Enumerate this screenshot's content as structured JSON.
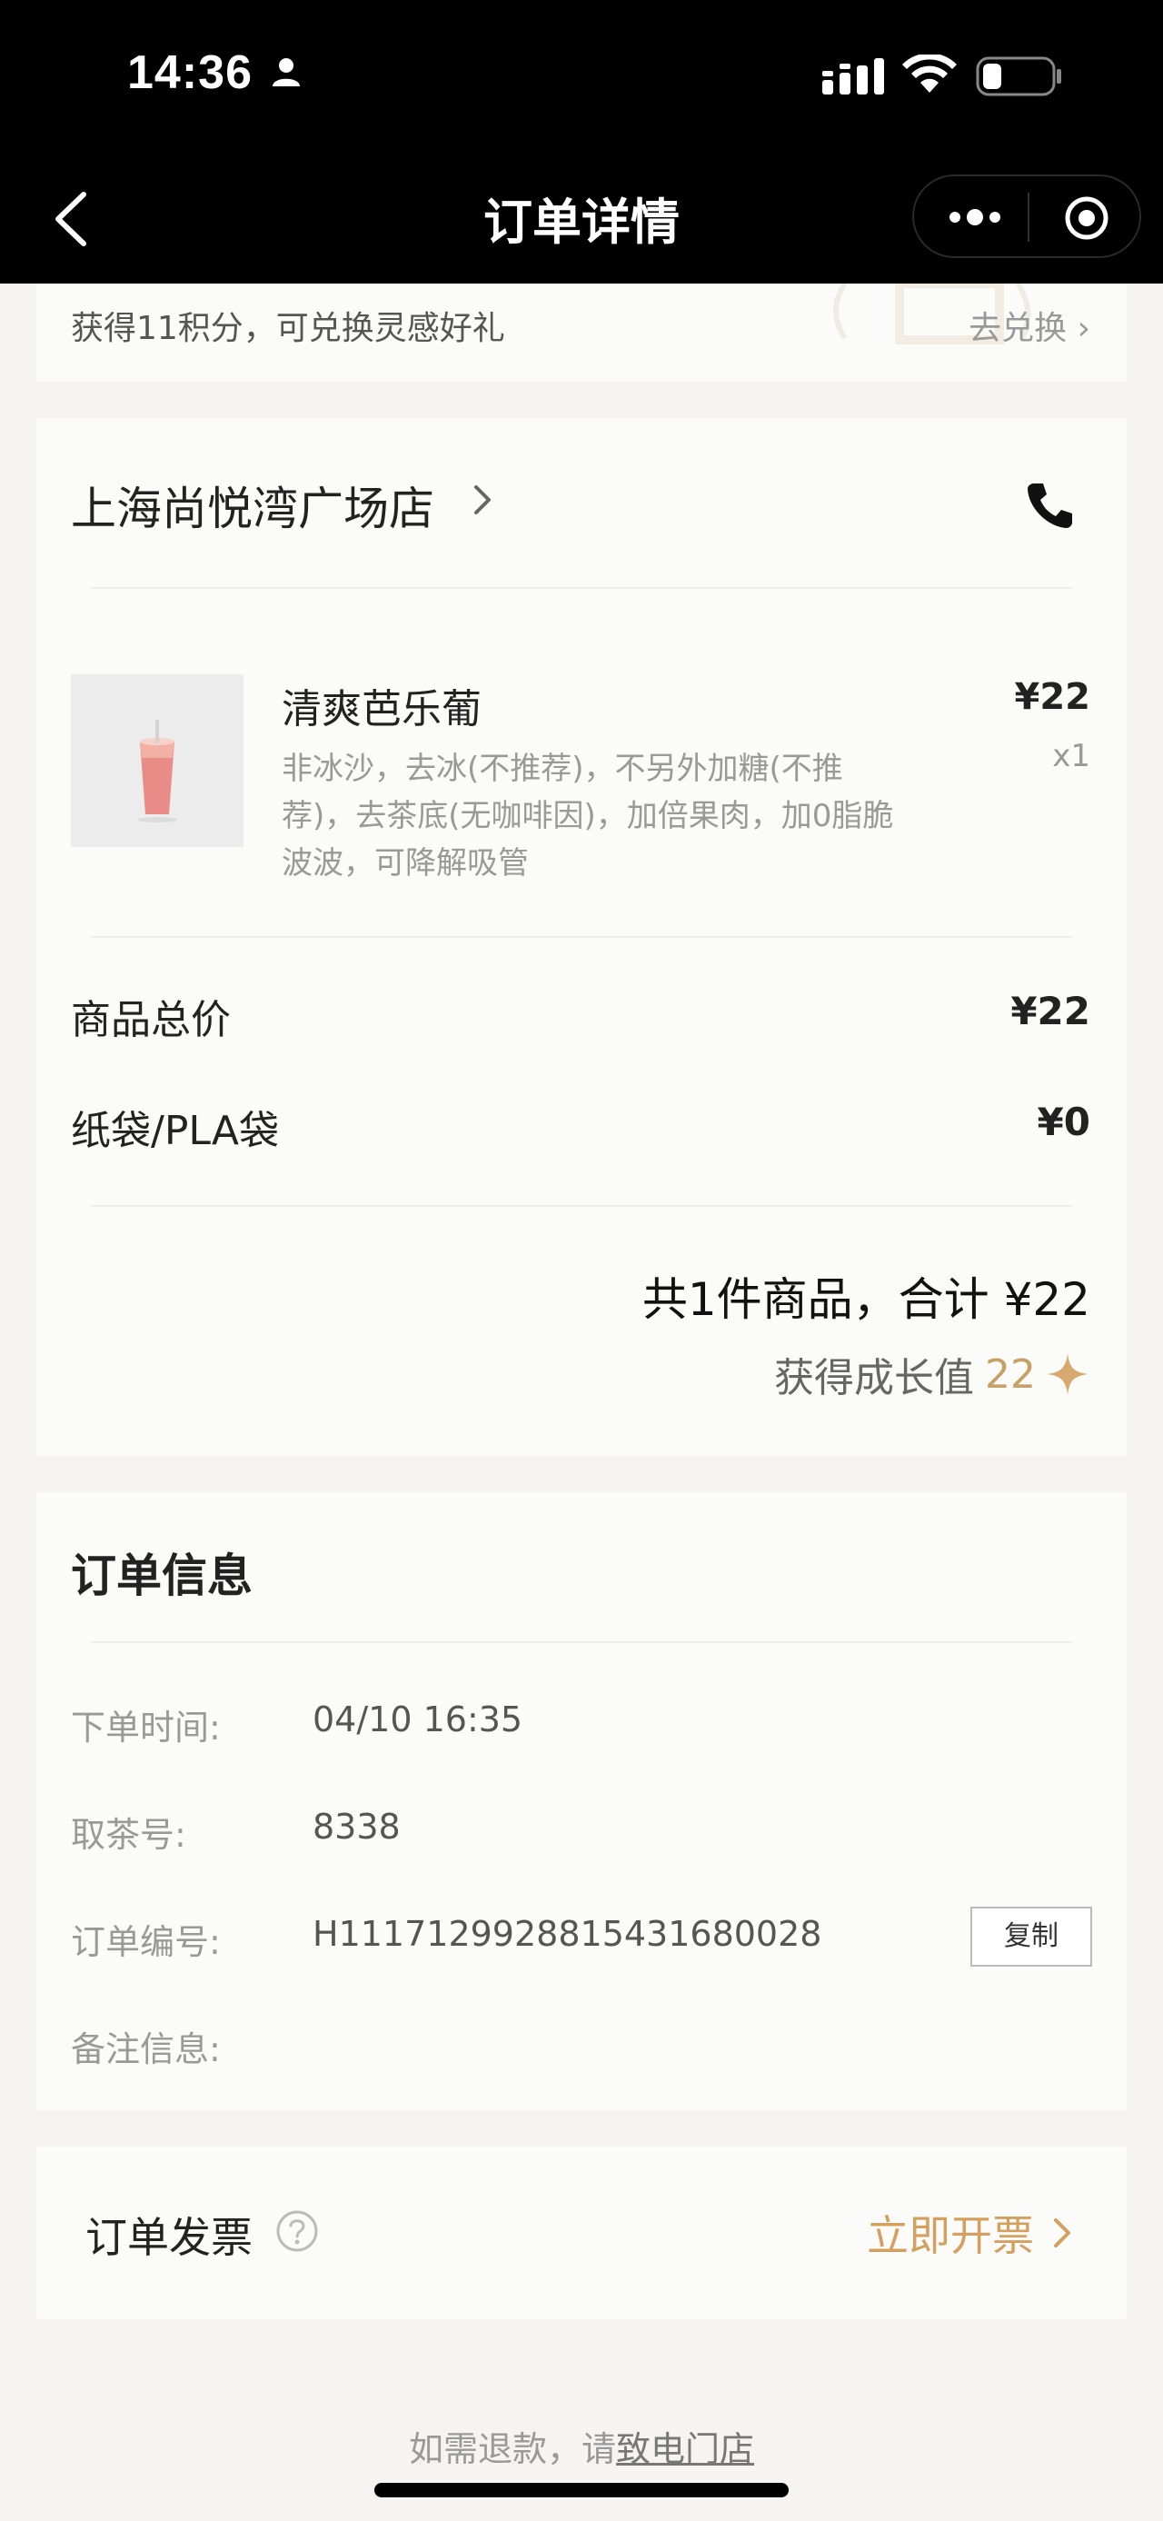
{
  "status_bar": {
    "time": "14:36"
  },
  "nav": {
    "title": "订单详情"
  },
  "points_card": {
    "text": "获得11积分，可兑换灵感好礼",
    "link": "去兑换"
  },
  "store": {
    "name": "上海尚悦湾广场店"
  },
  "product": {
    "name": "清爽芭乐葡",
    "price": "¥22",
    "qty": "x1",
    "spec": "非冰沙，去冰(不推荐)，不另外加糖(不推荐)，去茶底(无咖啡因)，加倍果肉，加0脂脆波波，可降解吸管"
  },
  "summary": {
    "rows": [
      {
        "label": "商品总价",
        "value": "¥22"
      },
      {
        "label": "纸袋/PLA袋",
        "value": "¥0"
      }
    ],
    "total": "共1件商品，合计 ¥22",
    "growth_label": "获得成长值",
    "growth_value": "22"
  },
  "order_info": {
    "title": "订单信息",
    "rows": [
      {
        "label": "下单时间:",
        "value": "04/10 16:35"
      },
      {
        "label": "取茶号:",
        "value": "8338"
      },
      {
        "label": "订单编号:",
        "value": "H1117129928815431680028"
      },
      {
        "label": "备注信息:",
        "value": ""
      }
    ],
    "copy_button": "复制"
  },
  "invoice": {
    "label": "订单发票",
    "link": "立即开票"
  },
  "refund": {
    "prefix": "如需退款，请",
    "link": "致电门店"
  },
  "colors": {
    "accent": "#d4a060",
    "growth": "#c8a065",
    "background": "#f5f4f2",
    "card": "#fbfbf9"
  }
}
